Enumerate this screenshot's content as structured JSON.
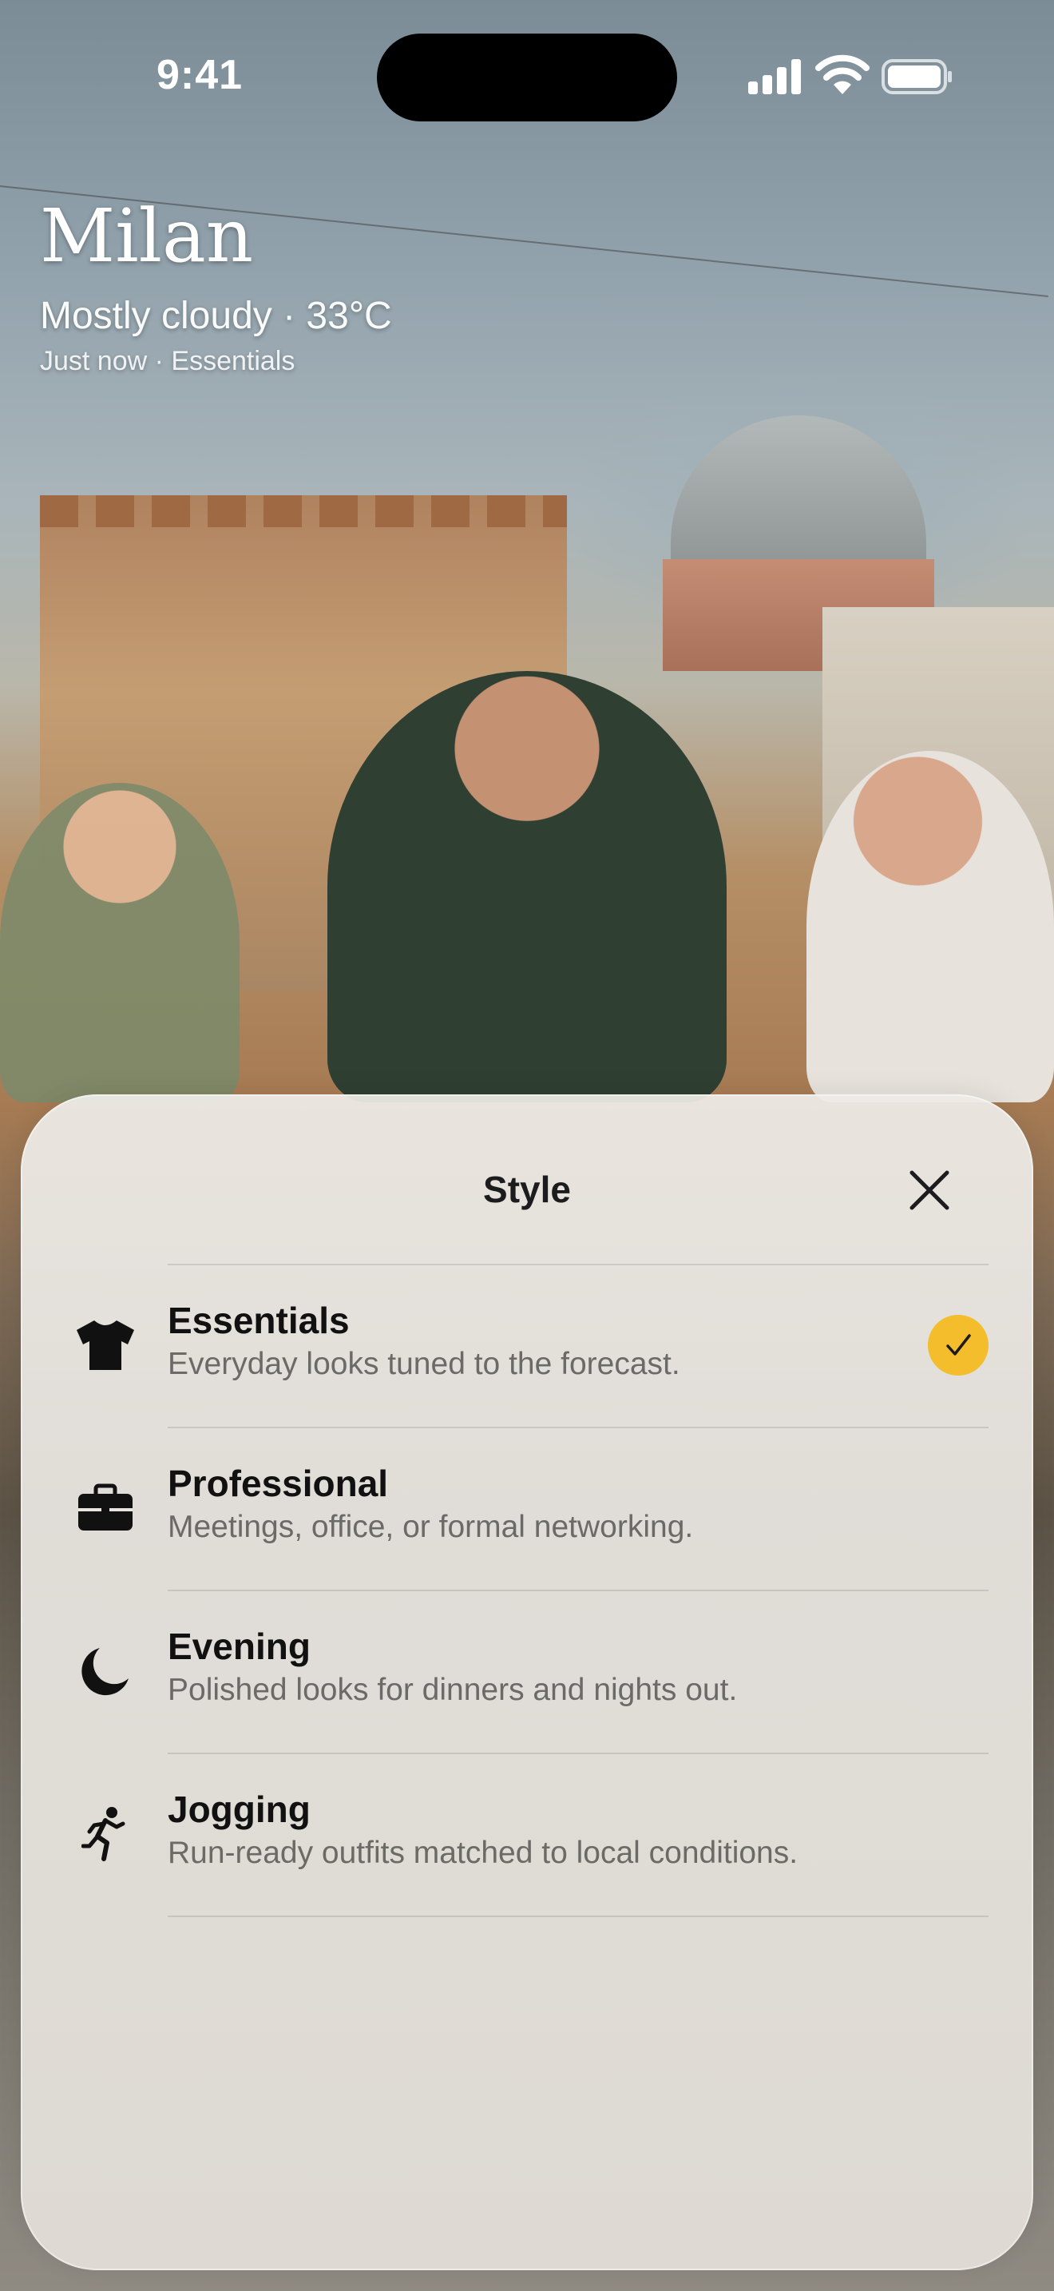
{
  "status_bar": {
    "time": "9:41"
  },
  "header": {
    "city": "Milan",
    "weather": "Mostly cloudy · 33°C",
    "subtitle": "Just now · Essentials"
  },
  "sheet": {
    "title": "Style",
    "selected_index": 0,
    "options": [
      {
        "icon": "tshirt-icon",
        "title": "Essentials",
        "description": "Everyday looks tuned to the forecast."
      },
      {
        "icon": "briefcase-icon",
        "title": "Professional",
        "description": "Meetings, office, or formal networking."
      },
      {
        "icon": "moon-icon",
        "title": "Evening",
        "description": "Polished looks for dinners and nights out."
      },
      {
        "icon": "runner-icon",
        "title": "Jogging",
        "description": "Run-ready outfits matched to local conditions."
      }
    ]
  },
  "colors": {
    "accent": "#F3BD2C",
    "text_primary": "#111111",
    "text_secondary": "#6C6A67"
  }
}
